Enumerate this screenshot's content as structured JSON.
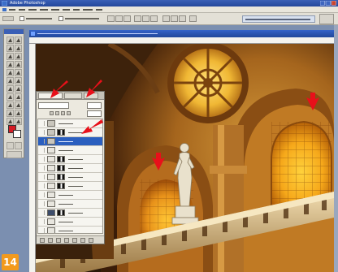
{
  "window": {
    "app_title": "Adobe Photoshop",
    "menu_items": [
      "",
      "",
      "",
      "",
      "",
      "",
      "",
      "",
      ""
    ]
  },
  "options_bar": {
    "workspace_menu": ""
  },
  "toolbox": {
    "tools": [
      "marquee-icon",
      "move-icon",
      "lasso-icon",
      "magic-wand-icon",
      "crop-icon",
      "slice-icon",
      "healing-brush-icon",
      "brush-icon",
      "clone-stamp-icon",
      "history-brush-icon",
      "eraser-icon",
      "gradient-icon",
      "blur-icon",
      "dodge-icon",
      "path-selection-icon",
      "type-icon",
      "pen-icon",
      "shape-icon",
      "notes-icon",
      "eyedropper-icon",
      "hand-icon",
      "zoom-icon"
    ],
    "foreground_color": "#d41b24",
    "background_color": "#ffffff"
  },
  "document": {
    "title": ""
  },
  "layers_palette": {
    "tabs": [
      "",
      "",
      ""
    ],
    "blend_mode": "",
    "opacity": "",
    "fill": "",
    "layers": [
      {
        "name": "",
        "visible": true,
        "has_mask": false,
        "active": false
      },
      {
        "name": "",
        "visible": true,
        "has_mask": true,
        "active": false
      },
      {
        "name": "",
        "visible": true,
        "has_mask": false,
        "active": true
      },
      {
        "name": "",
        "visible": true,
        "has_mask": false,
        "active": false
      },
      {
        "name": "",
        "visible": true,
        "has_mask": true,
        "active": false
      },
      {
        "name": "",
        "visible": true,
        "has_mask": true,
        "active": false
      },
      {
        "name": "",
        "visible": true,
        "has_mask": true,
        "active": false
      },
      {
        "name": "",
        "visible": true,
        "has_mask": true,
        "active": false
      },
      {
        "name": "",
        "visible": true,
        "has_mask": false,
        "active": false
      },
      {
        "name": "",
        "visible": true,
        "has_mask": false,
        "active": false
      },
      {
        "name": "",
        "visible": true,
        "has_mask": true,
        "active": false
      },
      {
        "name": "",
        "visible": true,
        "has_mask": false,
        "active": false
      },
      {
        "name": "",
        "visible": true,
        "has_mask": false,
        "active": false
      }
    ]
  },
  "annotations": {
    "step_number": "14",
    "arrow_color": "#e8101a"
  },
  "colors": {
    "selection_blue": "#2b5fbf",
    "badge_orange": "#f39a1c"
  }
}
